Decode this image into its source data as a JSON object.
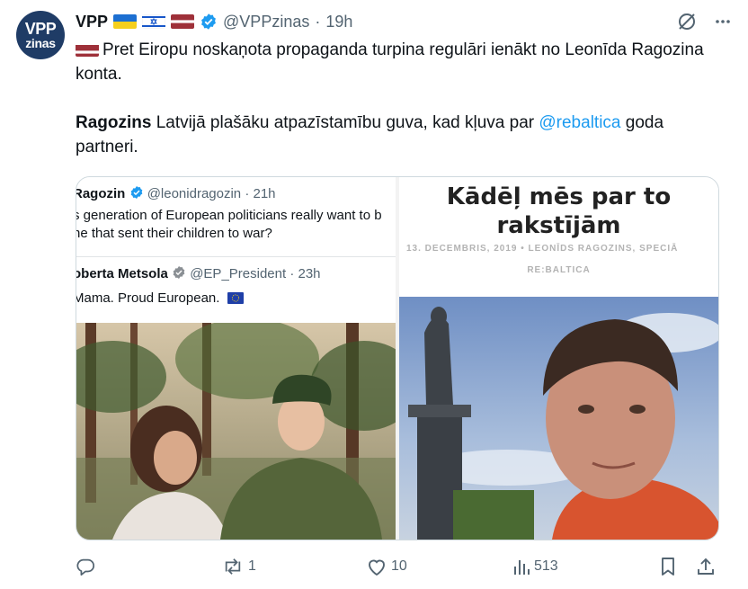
{
  "author": {
    "avatar_line1": "VPP",
    "avatar_line2": "zinas",
    "name": "VPP",
    "handle": "@VPPzinas",
    "separator": "·",
    "time": "19h"
  },
  "tweet": {
    "line1": "Pret Eiropu noskaņota propaganda turpina regulāri ienākt no Leonīda Ragozina konta.",
    "bold_word": "Ragozins",
    "line2_rest": " Latvijā plašāku atpazīstamību guva, kad kļuva par ",
    "mention": "@rebaltica",
    "line2_end": " goda partneri."
  },
  "quoted_1": {
    "name": "Ragozin",
    "handle": "@leonidragozin · 21h",
    "text1": "s generation of European politicians really want to b",
    "text2": "ne that sent their children to war?"
  },
  "quoted_2": {
    "name": "oberta Metsola",
    "handle": "@EP_President · 23h",
    "text": "Mama. Proud European."
  },
  "article": {
    "title_line1": "Kādēļ mēs par to",
    "title_line2": "rakstījām",
    "byline": "13. DECEMBRIS, 2019  •  LEONĪDS RAGOZINS, SPECIĀ",
    "source": "RE:BALTICA"
  },
  "actions": {
    "replies": "",
    "reposts": "1",
    "likes": "10",
    "views": "513"
  },
  "icons": [
    "reply-icon",
    "repost-icon",
    "like-icon",
    "views-icon",
    "bookmark-icon",
    "share-icon",
    "grok-icon",
    "more-icon",
    "verified-icon"
  ],
  "colors": {
    "accent": "#1d9bf0",
    "muted": "#536471",
    "avatar_bg": "#1f3c66"
  }
}
